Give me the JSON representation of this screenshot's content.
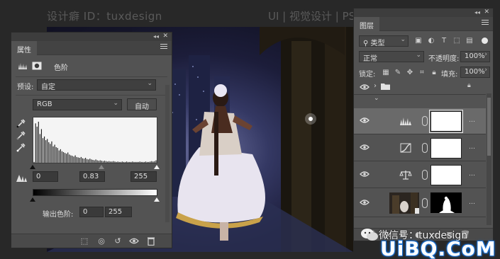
{
  "watermark_top": "设计癖 ID：tuxdesign",
  "watermark_top_right": "UI | 视觉设计 | PS",
  "properties": {
    "tab": "属性",
    "adjustment_name": "色阶",
    "preset_label": "预设:",
    "preset_value": "自定",
    "channel_value": "RGB",
    "auto_label": "自动",
    "input_black": "0",
    "input_gamma": "0.83",
    "input_white": "255",
    "output_label": "输出色阶:",
    "output_black": "0",
    "output_white": "255"
  },
  "layers": {
    "tab": "图层",
    "filter_kind": "类型",
    "blend_mode": "正常",
    "opacity_label": "不透明度:",
    "opacity_value": "100%",
    "lock_label": "锁定:",
    "fill_label": "填充:",
    "fill_value": "100%",
    "footer_icons": [
      "link-icon",
      "fx-icon",
      "mask-icon",
      "adjustment-icon",
      "folder-icon",
      "new-layer-icon",
      "trash-icon"
    ],
    "rows": [
      {
        "type": "group",
        "icon": "folder-icon"
      },
      {
        "type": "adjustment",
        "icon": "levels-icon",
        "selected": true
      },
      {
        "type": "adjustment",
        "icon": "curves-icon",
        "selected": false
      },
      {
        "type": "adjustment",
        "icon": "balance-icon",
        "selected": false
      },
      {
        "type": "image",
        "icon": "photo-thumbnail",
        "selected": false
      }
    ]
  },
  "wechat_watermark": "微信号：tuxdesign",
  "site_watermark": "UiBQ.CoM",
  "histogram": {
    "type": "histogram",
    "bins": [
      2,
      96,
      88,
      100,
      70,
      82,
      60,
      64,
      55,
      58,
      50,
      46,
      52,
      40,
      44,
      38,
      36,
      30,
      33,
      28,
      26,
      24,
      22,
      25,
      20,
      18,
      17,
      15,
      18,
      14,
      13,
      12,
      14,
      11,
      10,
      12,
      9,
      8,
      10,
      8,
      7,
      6,
      8,
      6,
      5,
      6,
      5,
      4,
      5,
      4,
      3,
      4,
      3,
      3,
      4,
      3,
      2,
      3,
      2,
      2,
      3,
      2,
      2,
      3,
      2,
      2,
      2,
      3,
      2,
      2,
      2,
      2,
      3,
      2,
      2,
      2,
      3,
      2,
      2,
      3,
      4,
      3,
      4,
      6
    ]
  }
}
